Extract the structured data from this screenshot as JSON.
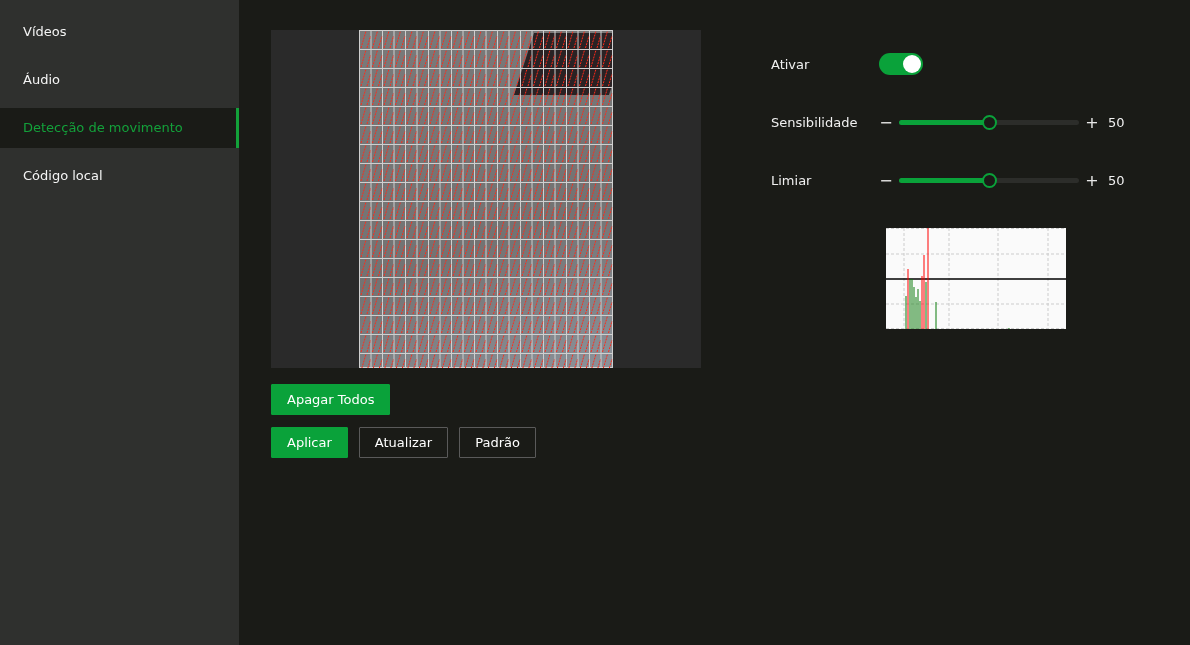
{
  "sidebar": {
    "items": [
      {
        "label": "Vídeos",
        "selected": false
      },
      {
        "label": "Áudio",
        "selected": false
      },
      {
        "label": "Detecção de movimento",
        "selected": true
      },
      {
        "label": "Código local",
        "selected": false
      }
    ]
  },
  "region_buttons": [
    {
      "label": "Apagar Todos",
      "kind": "primary"
    }
  ],
  "action_buttons": [
    {
      "label": "Aplicar",
      "kind": "primary"
    },
    {
      "label": "Atualizar",
      "kind": "outline"
    },
    {
      "label": "Padrão",
      "kind": "outline"
    }
  ],
  "settings": [
    {
      "kind": "toggle",
      "label": "Ativar",
      "on": true
    },
    {
      "kind": "slider",
      "label": "Sensibilidade",
      "minus": "−",
      "plus": "+",
      "level": 0.5,
      "reading": "50"
    },
    {
      "kind": "slider",
      "label": "Limiar",
      "minus": "−",
      "plus": "+",
      "level": 0.5,
      "reading": "50"
    }
  ]
}
